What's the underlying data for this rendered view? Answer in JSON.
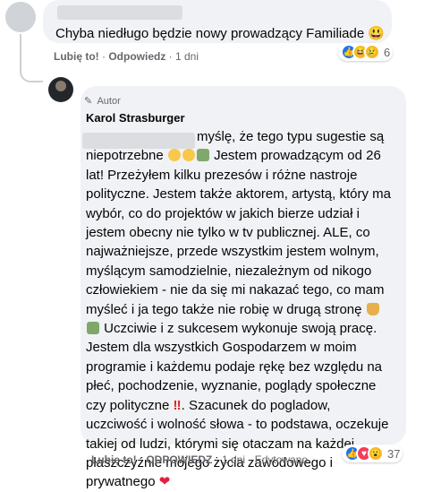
{
  "comment1": {
    "text": "Chyba niedługo będzie nowy prowadzący Familiade 😃",
    "like_label": "Lubię to!",
    "reply_label": "Odpowiedz",
    "time": "1 dni",
    "reaction_count": "6"
  },
  "reply": {
    "author_badge": "Autor",
    "author_name": "Karol Strasburger",
    "lines": [
      "myślę, że tego typu sugestie są",
      "niepotrzebne",
      "Jestem prowadzącym od 26",
      "lat! Przeżyłem kilku prezesów i różne nastroje",
      "polityczne. Jestem także aktorem, artystą, który ma",
      "wybór, co do projektów w jakich bierze udział i",
      "jestem obecny nie tylko w tv publicznej. ALE, co",
      "najważniejsze, przede wszystkim jestem wolnym,",
      "myślącym samodzielnie, niezależnym od nikogo",
      "człowiekiem - nie da się mi nakazać tego, co mam",
      "myśleć i ja tego także nie robię w drugą stronę",
      "Uczciwie i z sukcesem wykonuje swoją pracę.",
      "Jestem dla wszystkich Gospodarzem w moim",
      "programie i każdemu podaje rękę bez względu na",
      "płeć, pochodzenie, wyznanie, poglądy społeczne",
      "czy polityczne",
      "Szacunek do pogladow,",
      "uczciwość i wolność słowa - to podstawa, oczekuje",
      "takiej od ludzi, którymi się otaczam na każdej",
      "płaszczyźnie mojego życia zawodowego i",
      "prywatnego"
    ],
    "like_label": "Lubię to!",
    "reply_label": "ODPOWIEDZ",
    "time": "1 dni",
    "edited_label": "Edytowano",
    "reaction_count": "37"
  },
  "icons": [
    "like-icon",
    "haha-icon",
    "sad-icon",
    "love-icon",
    "pencil-icon",
    "pray-icon",
    "heart-icon",
    "exclamation-icon"
  ],
  "colors": {
    "bubble": "#f0f2f5",
    "meta": "#65676b",
    "like_blue": "#1877f2"
  }
}
